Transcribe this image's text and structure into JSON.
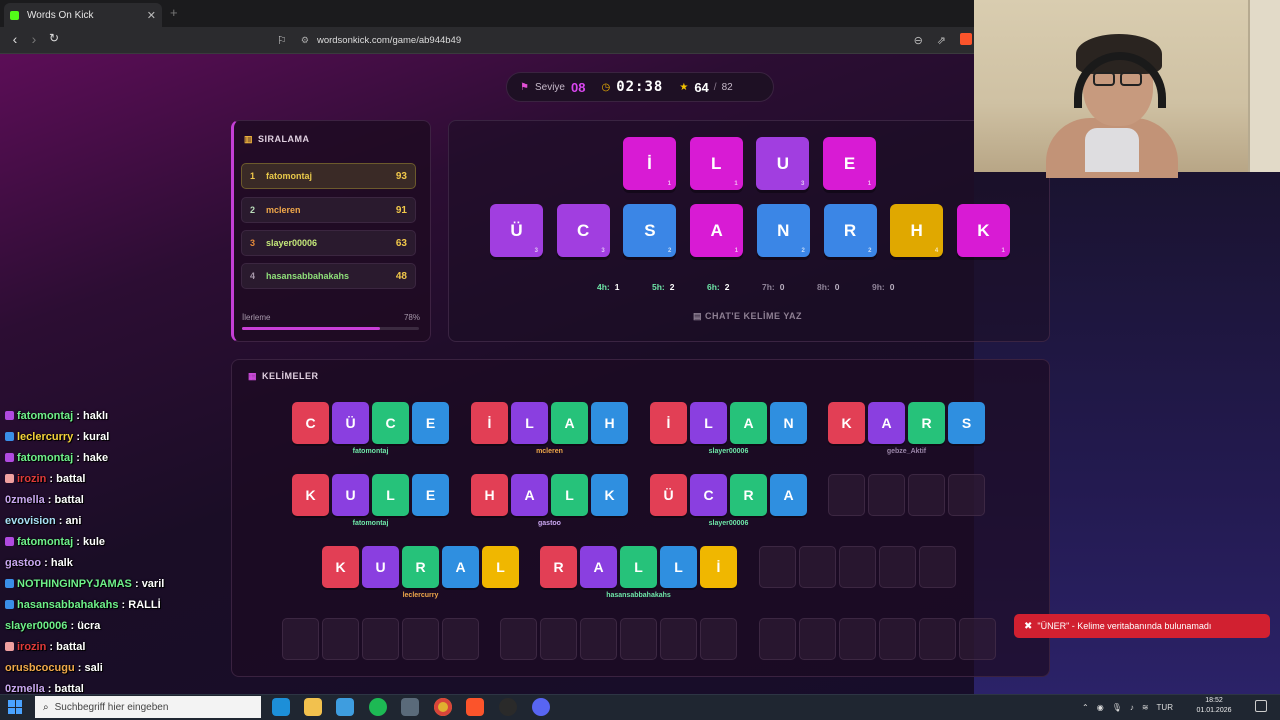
{
  "browser": {
    "tab_title": "Words On Kick",
    "url": "wordsonkick.com/game/ab944b49"
  },
  "stats": {
    "level_label": "Seviye",
    "level_value": "08",
    "timer": "02:38",
    "score": "64",
    "score_total": "82"
  },
  "leaderboard": {
    "title": "SIRALAMA",
    "rows": [
      {
        "rank": "1",
        "name": "fatomontaj",
        "points": "93"
      },
      {
        "rank": "2",
        "name": "mcleren",
        "points": "91"
      },
      {
        "rank": "3",
        "name": "slayer00006",
        "points": "63"
      },
      {
        "rank": "4",
        "name": "hasansabbahakahs",
        "points": "48"
      }
    ],
    "progress_label": "İlerleme",
    "progress_text": "78%",
    "progress_value": 0.78
  },
  "board": {
    "row1": [
      {
        "letter": "İ",
        "value": "1",
        "color": "#d81bd4"
      },
      {
        "letter": "L",
        "value": "1",
        "color": "#d81bd4"
      },
      {
        "letter": "U",
        "value": "3",
        "color": "#a13ee0"
      },
      {
        "letter": "E",
        "value": "1",
        "color": "#d81bd4"
      }
    ],
    "row2": [
      {
        "letter": "Ü",
        "value": "3",
        "color": "#a13ee0"
      },
      {
        "letter": "C",
        "value": "3",
        "color": "#a13ee0"
      },
      {
        "letter": "S",
        "value": "2",
        "color": "#3b86e6"
      },
      {
        "letter": "A",
        "value": "1",
        "color": "#d81bd4"
      },
      {
        "letter": "N",
        "value": "2",
        "color": "#3b86e6"
      },
      {
        "letter": "R",
        "value": "2",
        "color": "#3b86e6"
      },
      {
        "letter": "H",
        "value": "4",
        "color": "#e0a800"
      },
      {
        "letter": "K",
        "value": "1",
        "color": "#d81bd4"
      }
    ],
    "counts": [
      {
        "key": "4h:",
        "val": "1",
        "active": true
      },
      {
        "key": "5h:",
        "val": "2",
        "active": true
      },
      {
        "key": "6h:",
        "val": "2",
        "active": true
      },
      {
        "key": "7h:",
        "val": "0",
        "active": false
      },
      {
        "key": "8h:",
        "val": "0",
        "active": false
      },
      {
        "key": "9h:",
        "val": "0",
        "active": false
      }
    ],
    "chat_hint": "CHAT'E KELİME YAZ"
  },
  "words": {
    "title": "KELİMELER",
    "found": [
      {
        "letters": [
          "C",
          "Ü",
          "C",
          "E"
        ],
        "owner": "fatomontaj",
        "owner_color": "#6ee7a8"
      },
      {
        "letters": [
          "İ",
          "L",
          "A",
          "H"
        ],
        "owner": "mcleren",
        "owner_color": "#f0a84a"
      },
      {
        "letters": [
          "İ",
          "L",
          "A",
          "N"
        ],
        "owner": "slayer00006",
        "owner_color": "#6ee7a8"
      },
      {
        "letters": [
          "K",
          "A",
          "R",
          "S"
        ],
        "owner": "gebze_Aktif",
        "owner_color": "#9a85a8"
      },
      {
        "letters": [
          "K",
          "U",
          "L",
          "E"
        ],
        "owner": "fatomontaj",
        "owner_color": "#6ee7a8"
      },
      {
        "letters": [
          "H",
          "A",
          "L",
          "K"
        ],
        "owner": "gastoo",
        "owner_color": "#c9a7f0"
      },
      {
        "letters": [
          "Ü",
          "C",
          "R",
          "A"
        ],
        "owner": "slayer00006",
        "owner_color": "#6ee7a8"
      },
      {
        "letters": [
          "K",
          "U",
          "R",
          "A",
          "L"
        ],
        "owner": "leclercurry",
        "owner_color": "#f0a84a"
      },
      {
        "letters": [
          "R",
          "A",
          "L",
          "L",
          "İ"
        ],
        "owner": "hasansabbahakahs",
        "owner_color": "#6ee7a8"
      }
    ],
    "palette": [
      "#e23f55",
      "#8a3fe0",
      "#26c27a",
      "#2f8fe0",
      "#f0b700"
    ]
  },
  "toast": {
    "text": "\"ÜNER\" - Kelime veritabanında bulunamadı"
  },
  "chat": [
    {
      "user": "fatomontaj",
      "color": "#6ef08a",
      "msg": "haklı",
      "badge": "#b04ae0"
    },
    {
      "user": "leclercurry",
      "color": "#f5d23a",
      "msg": "kural",
      "badge": "#3a8fe8"
    },
    {
      "user": "fatomontaj",
      "color": "#6ef08a",
      "msg": "hake",
      "badge": "#b04ae0"
    },
    {
      "user": "irozin",
      "color": "#e03a3a",
      "msg": "battal",
      "badge": "#f0a0a0"
    },
    {
      "user": "0zmella",
      "color": "#c9a7f0",
      "msg": "battal",
      "badge": ""
    },
    {
      "user": "evovision",
      "color": "#a8e0f5",
      "msg": "ani",
      "badge": ""
    },
    {
      "user": "fatomontaj",
      "color": "#6ef08a",
      "msg": "kule",
      "badge": "#b04ae0"
    },
    {
      "user": "gastoo",
      "color": "#c9a7f0",
      "msg": "halk",
      "badge": ""
    },
    {
      "user": "NOTHINGINPYJAMAS",
      "color": "#6ef08a",
      "msg": "varil",
      "badge": "#3a8fe8"
    },
    {
      "user": "hasansabbahakahs",
      "color": "#6ef08a",
      "msg": "RALLİ",
      "badge": "#3a8fe8"
    },
    {
      "user": "slayer00006",
      "color": "#6ef08a",
      "msg": "ücra",
      "badge": ""
    },
    {
      "user": "irozin",
      "color": "#e03a3a",
      "msg": "battal",
      "badge": "#f0a0a0"
    },
    {
      "user": "orusbcocugu",
      "color": "#f0a84a",
      "msg": "sali",
      "badge": ""
    },
    {
      "user": "0zmella",
      "color": "#c9a7f0",
      "msg": "battal",
      "badge": ""
    }
  ],
  "taskbar": {
    "search_placeholder": "Suchbegriff hier eingeben",
    "lang": "TUR",
    "time": "18:52",
    "date": "01.01.2026"
  }
}
